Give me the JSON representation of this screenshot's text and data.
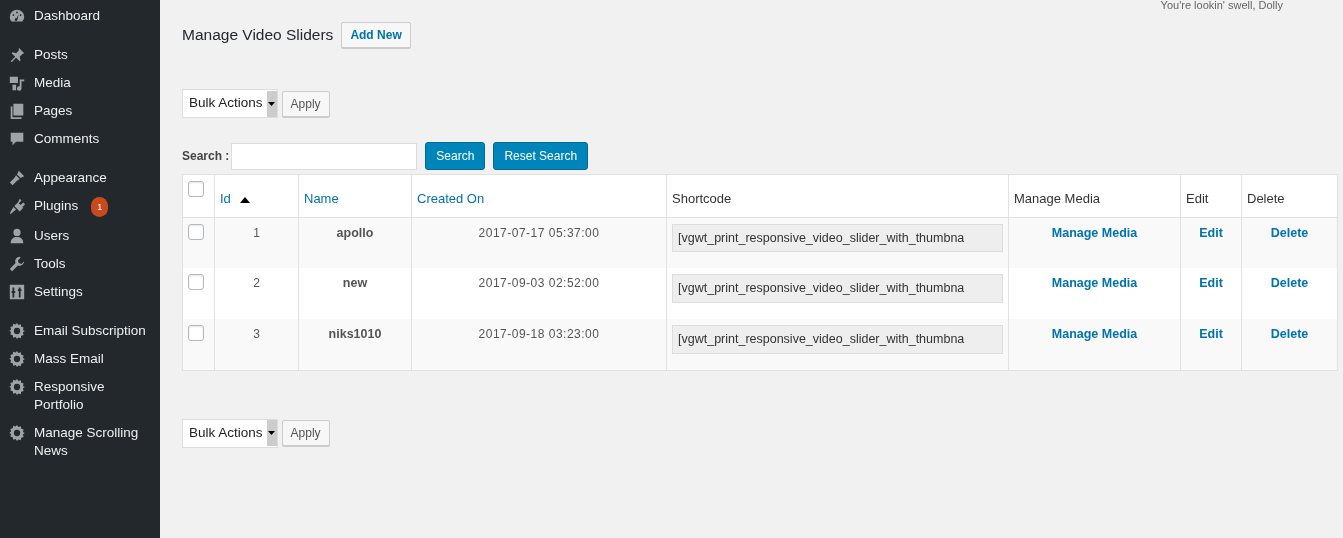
{
  "sidebar": {
    "groups": [
      [
        {
          "label": "Dashboard"
        }
      ],
      [
        {
          "label": "Posts"
        },
        {
          "label": "Media"
        },
        {
          "label": "Pages"
        },
        {
          "label": "Comments"
        }
      ],
      [
        {
          "label": "Appearance"
        },
        {
          "label": "Plugins",
          "badge": "1"
        },
        {
          "label": "Users"
        },
        {
          "label": "Tools"
        },
        {
          "label": "Settings"
        }
      ],
      [
        {
          "label": "Email Subscription"
        },
        {
          "label": "Mass Email"
        },
        {
          "label": "Responsive Portfolio"
        },
        {
          "label": "Manage Scrolling News"
        }
      ]
    ]
  },
  "greeting": "You're lookin' swell, Dolly",
  "page": {
    "title": "Manage Video Sliders",
    "add_button": "Add New"
  },
  "bulk_top": {
    "select": "Bulk Actions",
    "apply": "Apply"
  },
  "search": {
    "label": "Search :",
    "buttons": [
      "Search",
      "Reset Search"
    ]
  },
  "table": {
    "select_all": {
      "checked": false
    },
    "columns": [
      {
        "label": "Id",
        "link": true,
        "sorted": true
      },
      {
        "label": "Name",
        "link": true,
        "sorted": false
      },
      {
        "label": "Created On",
        "link": true,
        "sorted": false
      },
      {
        "label": "Shortcode",
        "link": false,
        "sorted": false
      },
      {
        "label": "Manage Media",
        "link": false,
        "sorted": false
      },
      {
        "label": "Edit",
        "link": false,
        "sorted": false
      },
      {
        "label": "Delete",
        "link": false,
        "sorted": false
      }
    ],
    "rows": [
      {
        "checked": false,
        "id": "1",
        "name": "apollo",
        "created": "2017-07-17 05:37:00",
        "shortcode": "[vgwt_print_responsive_video_slider_with_thumbna",
        "manage": "Manage Media",
        "edit": "Edit",
        "delete": "Delete"
      },
      {
        "checked": false,
        "id": "2",
        "name": "new",
        "created": "2017-09-03 02:52:00",
        "shortcode": "[vgwt_print_responsive_video_slider_with_thumbna",
        "manage": "Manage Media",
        "edit": "Edit",
        "delete": "Delete"
      },
      {
        "checked": false,
        "id": "3",
        "name": "niks1010",
        "created": "2017-09-18 03:23:00",
        "shortcode": "[vgwt_print_responsive_video_slider_with_thumbna",
        "manage": "Manage Media",
        "edit": "Edit",
        "delete": "Delete"
      }
    ]
  },
  "bulk_bottom": {
    "select": "Bulk Actions",
    "apply": "Apply"
  }
}
